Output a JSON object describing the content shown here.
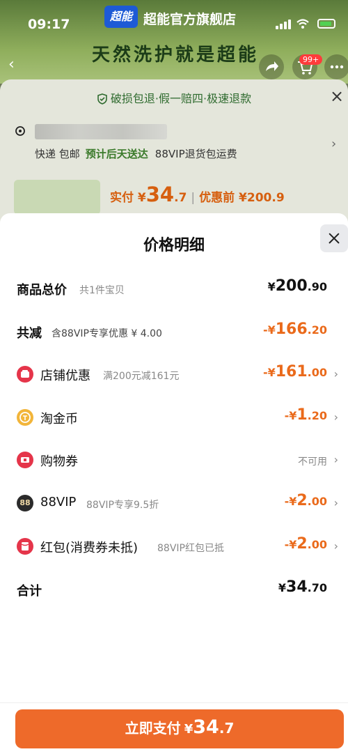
{
  "status": {
    "time": "09:17"
  },
  "store": {
    "logo_text": "超能",
    "name": "超能官方旗舰店",
    "slogan": "天然洗护就是超能"
  },
  "cart_badge": "99+",
  "sheet": {
    "guarantee": "破损包退·假一赔四·极速退款",
    "ship": {
      "method": "快递 包邮",
      "eta": "预计后天送达",
      "vip": "88VIP退货包运费"
    },
    "price": {
      "actual_label": "实付 ¥",
      "actual_int": "34",
      "actual_dec": ".7",
      "before": "优惠前 ¥200.9"
    }
  },
  "modal": {
    "title": "价格明细",
    "rows": [
      {
        "label": "商品总价",
        "sub": "共1件宝贝",
        "cur": "¥",
        "int": "200",
        "dec": ".90"
      },
      {
        "label": "共减",
        "sub": "含88VIP专享优惠 ¥ 4.00",
        "cur": "-¥",
        "int": "166",
        "dec": ".20"
      },
      {
        "label": "店铺优惠",
        "sub": "满200元减161元",
        "cur": "-¥",
        "int": "161",
        "dec": ".00"
      },
      {
        "label": "淘金币",
        "sub": "",
        "cur": "-¥",
        "int": "1",
        "dec": ".20"
      },
      {
        "label": "购物券",
        "sub": "",
        "status": "不可用"
      },
      {
        "label": "88VIP",
        "sub": "88VIP专享9.5折",
        "cur": "-¥",
        "int": "2",
        "dec": ".00"
      },
      {
        "label": "红包(消费券未抵)",
        "sub": "88VIP红包已抵",
        "cur": "-¥",
        "int": "2",
        "dec": ".00"
      },
      {
        "label": "合计",
        "sub": "",
        "cur": "¥",
        "int": "34",
        "dec": ".70"
      }
    ],
    "icons": {
      "88VIP": "88"
    }
  },
  "pay_button": {
    "label": "立即支付",
    "cur": "¥",
    "int": "34",
    "dec": ".7"
  },
  "colors": {
    "accent": "#ea6a1b",
    "pay_button": "#ee6a2a",
    "green": "#3a7a2a"
  }
}
